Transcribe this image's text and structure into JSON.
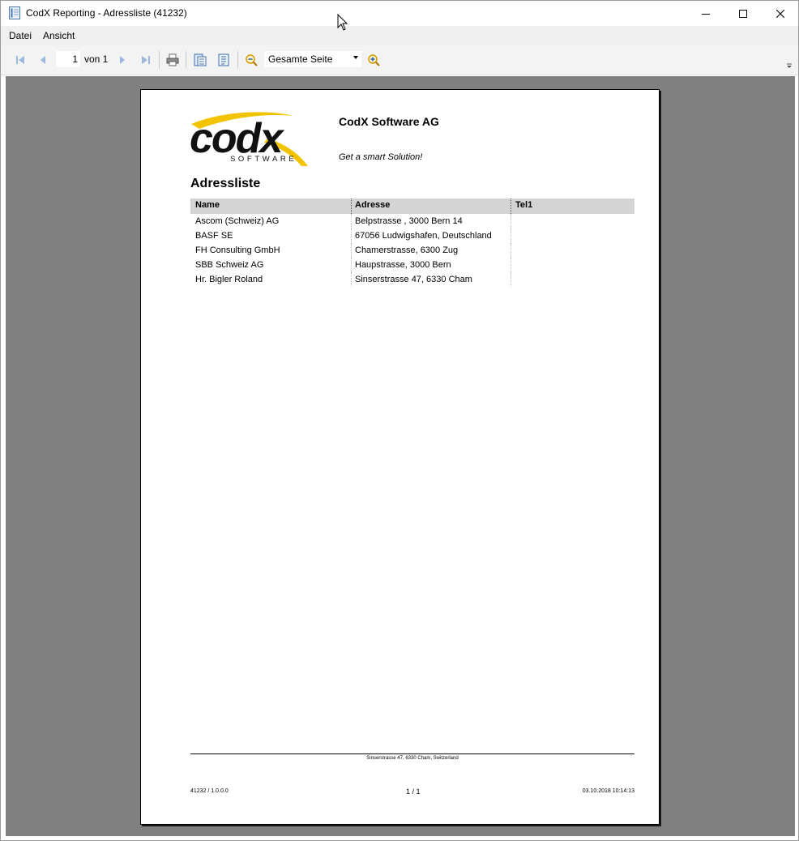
{
  "window": {
    "title": "CodX Reporting - Adressliste (41232)"
  },
  "menu": {
    "items": [
      {
        "label": "Datei"
      },
      {
        "label": "Ansicht"
      }
    ]
  },
  "toolbar": {
    "page_number": "1",
    "page_of": "von 1",
    "zoom_value": "Gesamte Seite"
  },
  "icons": {
    "first_page": "first-page-icon",
    "prev_page": "prev-page-icon",
    "next_page": "next-page-icon",
    "last_page": "last-page-icon",
    "print": "printer-icon",
    "export": "export-icon",
    "page_setup": "page-setup-icon",
    "zoom_out": "zoom-out-icon",
    "zoom_in": "zoom-in-icon"
  },
  "colors": {
    "logo_accent": "#f2c400",
    "preview_bg": "#808080",
    "header_row": "#d4d4d4"
  },
  "report": {
    "logo_text": "codx",
    "logo_subtext": "SOFTWARE",
    "company": "CodX Software AG",
    "slogan": "Get a smart Solution!",
    "title": "Adressliste",
    "columns": [
      "Name",
      "Adresse",
      "Tel1"
    ],
    "rows": [
      {
        "name": "Ascom (Schweiz) AG",
        "address": "Belpstrasse , 3000 Bern 14",
        "tel": ""
      },
      {
        "name": "BASF SE",
        "address": "67056 Ludwigshafen, Deutschland",
        "tel": ""
      },
      {
        "name": "FH Consulting GmbH",
        "address": "Chamerstrasse, 6300 Zug",
        "tel": ""
      },
      {
        "name": "SBB Schweiz AG",
        "address": "Haupstrasse, 3000 Bern",
        "tel": ""
      },
      {
        "name": "Hr. Bigler Roland",
        "address": "Sinserstrasse 47, 6330 Cham",
        "tel": ""
      }
    ],
    "footer": {
      "address": "Sinserstrasse 47, 6330 Cham, Switzerland",
      "version": "41232 / 1.0.0.0",
      "page": "1 / 1",
      "timestamp": "03.10.2018 10:14:13"
    }
  }
}
